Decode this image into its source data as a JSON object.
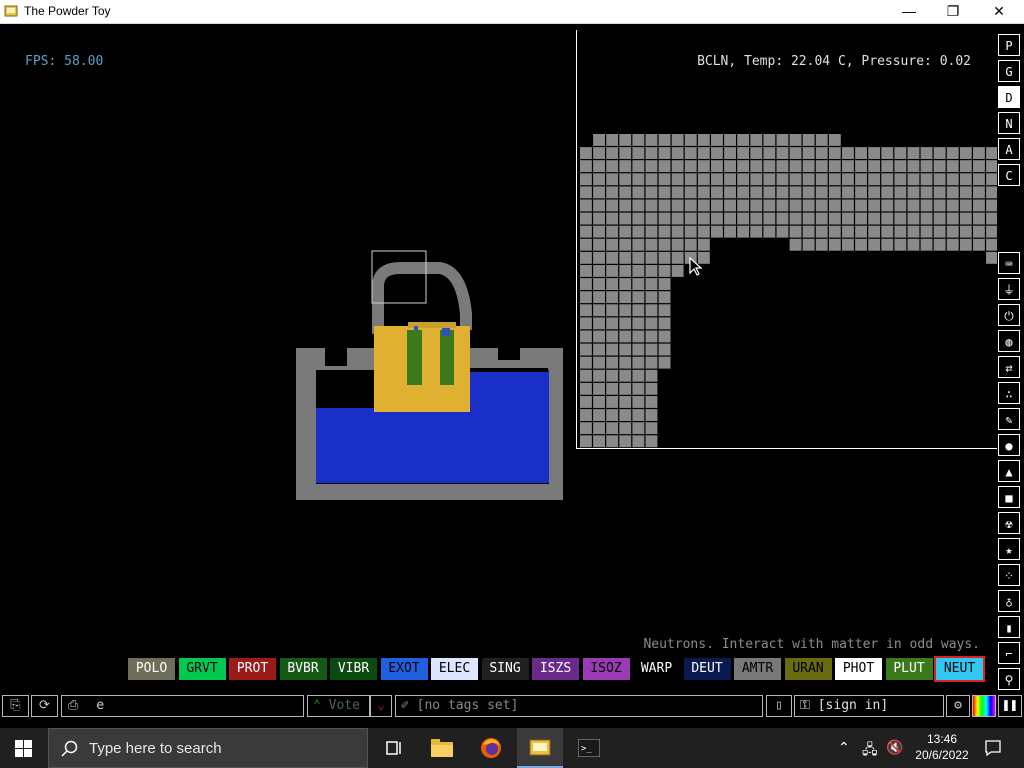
{
  "window": {
    "title": "The Powder Toy",
    "minimize_glyph": "—",
    "maximize_glyph": "❐",
    "close_glyph": "✕"
  },
  "hud": {
    "fps": "FPS: 58.00",
    "info": "BCLN, Temp: 22.04 C, Pressure: 0.02",
    "element_description": "Neutrons. Interact with matter in odd ways."
  },
  "right_toolbar": {
    "top_buttons": [
      "P",
      "G",
      "D",
      "N",
      "A",
      "C"
    ],
    "active_top": "D",
    "categories": [
      "keyboard-icon",
      "plug-icon",
      "power-icon",
      "gas-icon",
      "arrows-icon",
      "spray-icon",
      "pen-icon",
      "drop-icon",
      "flask-icon",
      "square-icon",
      "radiation-icon",
      "star-icon",
      "dots-icon",
      "bulb-icon",
      "bookmark-icon",
      "brush-icon",
      "magnifier-icon"
    ]
  },
  "elements": [
    {
      "label": "POLO",
      "bg": "#6e6e5a",
      "fg": "#ffffff"
    },
    {
      "label": "GRVT",
      "bg": "#00c850",
      "fg": "#000000"
    },
    {
      "label": "PROT",
      "bg": "#9b1a1a",
      "fg": "#ffffff"
    },
    {
      "label": "BVBR",
      "bg": "#145a14",
      "fg": "#ffffff"
    },
    {
      "label": "VIBR",
      "bg": "#0b4a10",
      "fg": "#ffffff"
    },
    {
      "label": "EXOT",
      "bg": "#2060e0",
      "fg": "#000000"
    },
    {
      "label": "ELEC",
      "bg": "#dce6ff",
      "fg": "#000000"
    },
    {
      "label": "SING",
      "bg": "#202020",
      "fg": "#ffffff"
    },
    {
      "label": "ISZS",
      "bg": "#6a2a8a",
      "fg": "#ffffff"
    },
    {
      "label": "ISOZ",
      "bg": "#9a3ab4",
      "fg": "#000000"
    },
    {
      "label": "WARP",
      "bg": "#000000",
      "fg": "#ffffff"
    },
    {
      "label": "DEUT",
      "bg": "#0a1a50",
      "fg": "#ffffff"
    },
    {
      "label": "AMTR",
      "bg": "#787878",
      "fg": "#000000"
    },
    {
      "label": "URAN",
      "bg": "#6a6a10",
      "fg": "#000000"
    },
    {
      "label": "PHOT",
      "bg": "#ffffff",
      "fg": "#000000"
    },
    {
      "label": "PLUT",
      "bg": "#3a7a1a",
      "fg": "#ffffff"
    },
    {
      "label": "NEUT",
      "bg": "#30c8f0",
      "fg": "#000000",
      "selected": true
    }
  ],
  "bottom_bar": {
    "search_value": "e",
    "vote_label": "Vote",
    "tags_label": "[no tags set]",
    "signin_label": "[sign in]"
  },
  "taskbar": {
    "search_placeholder": "Type here to search",
    "time": "13:46",
    "date": "20/6/2022"
  }
}
